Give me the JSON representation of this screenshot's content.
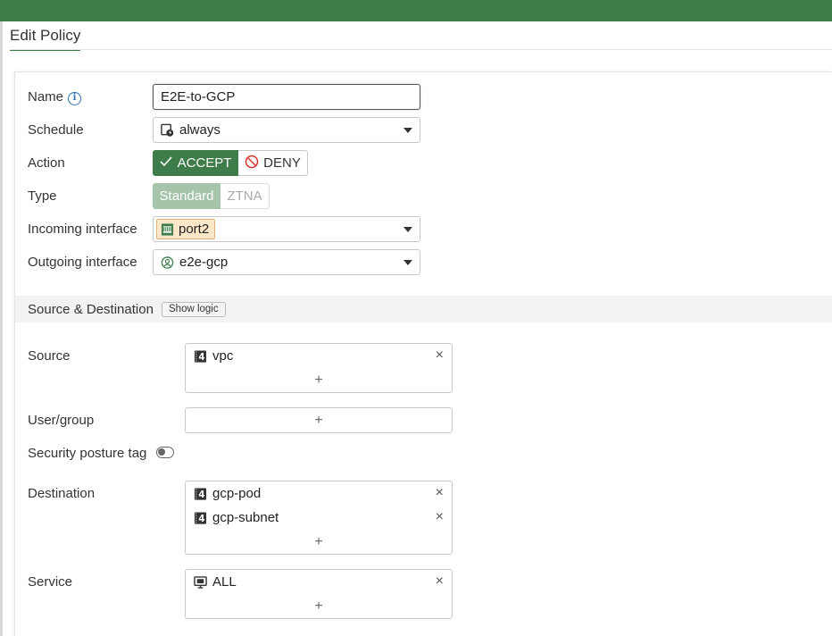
{
  "page": {
    "title": "Edit Policy"
  },
  "form": {
    "name": {
      "label": "Name",
      "value": "E2E-to-GCP"
    },
    "schedule": {
      "label": "Schedule",
      "value": "always"
    },
    "action": {
      "label": "Action",
      "accept": "ACCEPT",
      "deny": "DENY",
      "selected": "ACCEPT"
    },
    "type": {
      "label": "Type",
      "standard": "Standard",
      "ztna": "ZTNA",
      "selected": "Standard"
    },
    "incoming": {
      "label": "Incoming interface",
      "value": "port2"
    },
    "outgoing": {
      "label": "Outgoing interface",
      "value": "e2e-gcp"
    }
  },
  "section": {
    "title": "Source & Destination",
    "show_logic": "Show logic"
  },
  "source": {
    "label": "Source",
    "items": [
      "vpc"
    ],
    "add": "+"
  },
  "user_group": {
    "label": "User/group",
    "add": "+"
  },
  "security_posture": {
    "label": "Security posture tag",
    "enabled": false
  },
  "destination": {
    "label": "Destination",
    "items": [
      "gcp-pod",
      "gcp-subnet"
    ],
    "add": "+"
  },
  "service": {
    "label": "Service",
    "items": [
      "ALL"
    ],
    "add": "+"
  },
  "icons": {
    "remove": "×",
    "check": "✓"
  },
  "colors": {
    "accent": "#3e7d4a",
    "standard_selected": "#a5c4aa",
    "deny_red": "#d9342b",
    "chip_bg": "#fde7c9"
  }
}
